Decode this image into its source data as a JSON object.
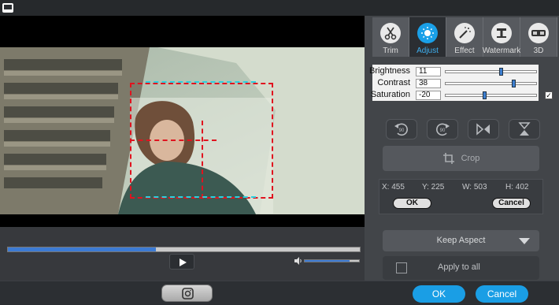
{
  "tabs": [
    {
      "label": "Trim",
      "icon": "scissors-icon"
    },
    {
      "label": "Adjust",
      "icon": "brightness-icon"
    },
    {
      "label": "Effect",
      "icon": "magic-wand-icon"
    },
    {
      "label": "Watermark",
      "icon": "watermark-icon"
    },
    {
      "label": "3D",
      "icon": "3d-glasses-icon"
    }
  ],
  "active_tab": "Adjust",
  "adjust": {
    "brightness": {
      "label": "Brightness",
      "value": "11",
      "level": 0.61
    },
    "contrast": {
      "label": "Contrast",
      "value": "38",
      "level": 0.75
    },
    "saturation": {
      "label": "Saturation",
      "value": "-20",
      "level": 0.42
    }
  },
  "rotate_icons": [
    "rotate-left-90-icon",
    "rotate-right-90-icon",
    "flip-horizontal-icon",
    "flip-vertical-icon"
  ],
  "crop": {
    "label": "Crop",
    "x": "X: 455",
    "y": "Y: 225",
    "w": "W: 503",
    "h": "H: 402",
    "ok": "OK",
    "cancel": "Cancel"
  },
  "aspect": {
    "label": "Keep Aspect"
  },
  "apply_all": {
    "label": "Apply to all"
  },
  "player": {
    "progress": 0.42,
    "volume": 0.82
  },
  "footer": {
    "ok": "OK",
    "cancel": "Cancel"
  },
  "colors": {
    "accent": "#1a9ee5",
    "crop_line": "#e0131f",
    "guide_line": "#2ad1e0"
  }
}
